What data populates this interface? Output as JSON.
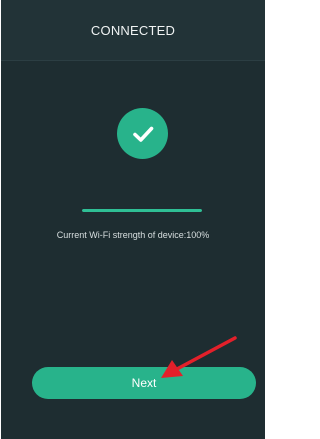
{
  "header": {
    "title": "CONNECTED"
  },
  "status": {
    "icon": "check-circle-icon",
    "wifi_strength_text": "Current Wi-Fi strength of device:100%",
    "wifi_strength_percent": 100
  },
  "actions": {
    "next_label": "Next"
  },
  "colors": {
    "background": "#1e2d31",
    "header_background": "#223337",
    "accent": "#28b38b",
    "annotation_arrow": "#e3202a"
  }
}
